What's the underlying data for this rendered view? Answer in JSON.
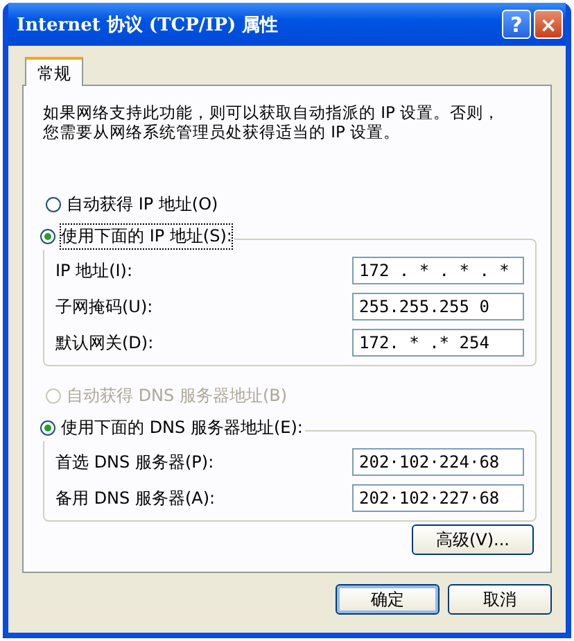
{
  "window": {
    "title": "Internet 协议 (TCP/IP) 属性",
    "buttons": [
      {
        "kind": "help",
        "label": "?"
      },
      {
        "kind": "close",
        "label": "×"
      }
    ]
  },
  "tabs": [
    {
      "label": "常规",
      "selected": true
    }
  ],
  "description": "如果网络支持此功能，则可以获取自动指派的 IP 设置。否则，您需要从网络系统管理员处获得适当的 IP 设置。",
  "ip_options": [
    {
      "label": "自动获得 IP 地址(O)",
      "selected": false,
      "disabled": false,
      "focused": false
    },
    {
      "label": "使用下面的 IP 地址(S):",
      "selected": true,
      "disabled": false,
      "focused": true,
      "fields": [
        {
          "label": "IP 地址(I):",
          "value": "172 . * . * . *"
        },
        {
          "label": "子网掩码(U):",
          "value": "255.255.255 0"
        },
        {
          "label": "默认网关(D):",
          "value": "172. * .* 254"
        }
      ]
    }
  ],
  "dns_options": [
    {
      "label": "自动获得 DNS 服务器地址(B)",
      "selected": false,
      "disabled": true,
      "focused": false
    },
    {
      "label": "使用下面的 DNS 服务器地址(E):",
      "selected": true,
      "disabled": false,
      "focused": false,
      "fields": [
        {
          "label": "首选 DNS 服务器(P):",
          "value": "202·102·224·68"
        },
        {
          "label": "备用 DNS 服务器(A):",
          "value": "202·102·227·68"
        }
      ]
    }
  ],
  "advanced_button": "高级(V)...",
  "footer_buttons": [
    {
      "label": "确定",
      "default": true
    },
    {
      "label": "取消",
      "default": false
    }
  ]
}
